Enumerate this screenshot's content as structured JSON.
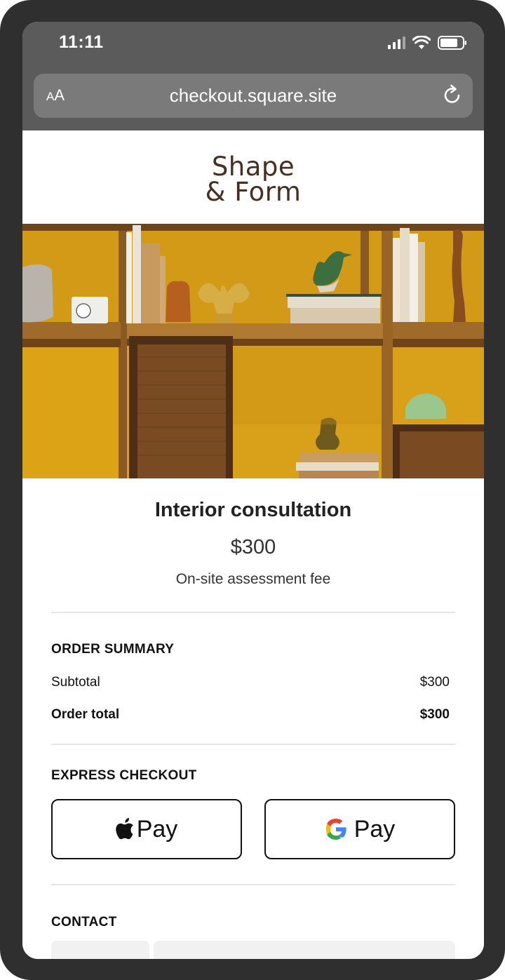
{
  "status_bar": {
    "time": "11:11"
  },
  "browser": {
    "text_size_label_small": "A",
    "text_size_label_large": "A",
    "url": "checkout.square.site"
  },
  "brand": {
    "line1": "Shape",
    "line2": "& Form",
    "color": "#4a2e22"
  },
  "product": {
    "title": "Interior consultation",
    "price": "$300",
    "description": "On-site assessment fee"
  },
  "order_summary": {
    "heading": "ORDER SUMMARY",
    "subtotal_label": "Subtotal",
    "subtotal_value": "$300",
    "total_label": "Order total",
    "total_value": "$300"
  },
  "express_checkout": {
    "heading": "EXPRESS CHECKOUT",
    "apple_pay_label": "Pay",
    "google_pay_label": "Pay"
  },
  "contact": {
    "heading": "CONTACT"
  },
  "icons": {
    "signal": "cellular-signal-icon",
    "wifi": "wifi-icon",
    "battery": "battery-icon",
    "reload": "reload-icon",
    "apple": "apple-logo-icon",
    "google": "google-g-logo-icon"
  }
}
